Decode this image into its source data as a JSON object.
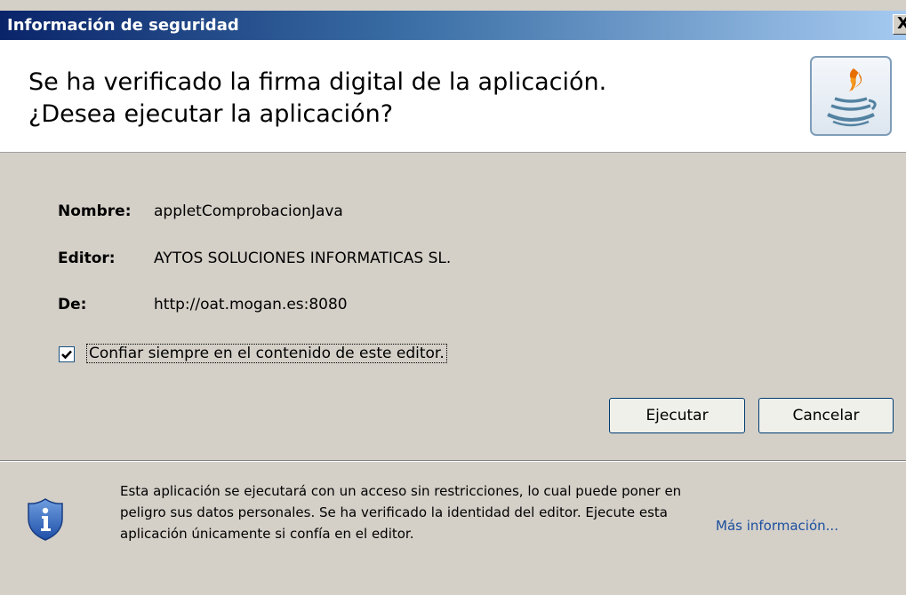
{
  "window": {
    "title": "Información de seguridad",
    "close_glyph": "X"
  },
  "header": {
    "line1": "Se ha verificado la firma digital de la aplicación.",
    "line2": "¿Desea ejecutar la aplicación?",
    "logo_icon": "java-coffee-cup-icon"
  },
  "details": {
    "name_label": "Nombre:",
    "name_value": "appletComprobacionJava",
    "publisher_label": "Editor:",
    "publisher_value": "AYTOS SOLUCIONES INFORMATICAS SL.",
    "from_label": "De:",
    "from_value": "http://oat.mogan.es:8080"
  },
  "trust_checkbox": {
    "label": "Confiar siempre en el contenido de este editor.",
    "checked": true
  },
  "buttons": {
    "run": "Ejecutar",
    "cancel": "Cancelar"
  },
  "footer": {
    "icon": "shield-info-icon",
    "warning": "Esta aplicación se ejecutará con un acceso sin restricciones, lo cual puede poner en peligro sus datos personales. Se ha verificado la identidad del editor. Ejecute esta aplicación únicamente si confía en el editor.",
    "more_info": "Más información..."
  },
  "colors": {
    "titlebar_start": "#0a246a",
    "titlebar_end": "#a6caf0",
    "dialog_bg": "#d4d0c8",
    "link": "#1c4fa0"
  }
}
